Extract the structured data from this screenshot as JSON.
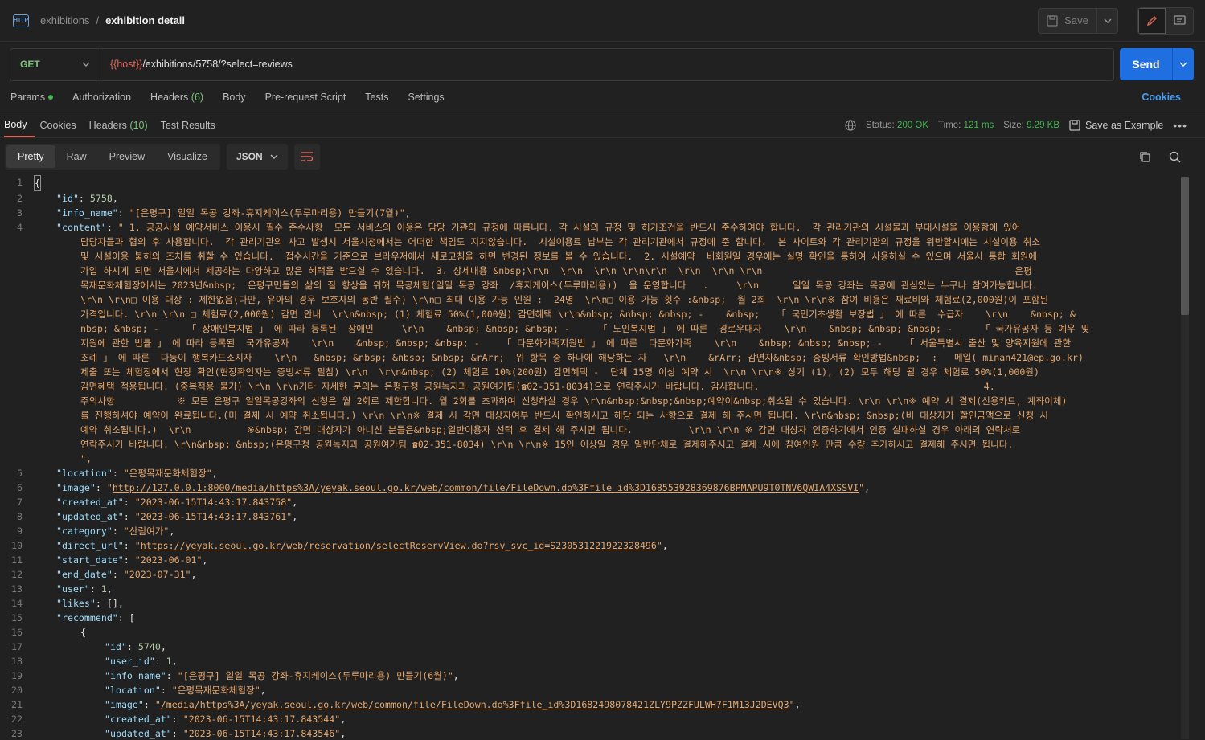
{
  "breadcrumb": {
    "parent": "exhibitions",
    "separator": "/",
    "current": "exhibition detail",
    "icon": "http-icon"
  },
  "toolbar": {
    "save_label": "Save"
  },
  "request": {
    "method": "GET",
    "url_var": "{{host}}",
    "url_path": "/exhibitions/5758/?select=reviews",
    "send_label": "Send"
  },
  "request_tabs": {
    "params": "Params",
    "authorization": "Authorization",
    "headers": "Headers",
    "headers_count": "(6)",
    "body": "Body",
    "prerequest": "Pre-request Script",
    "tests": "Tests",
    "settings": "Settings",
    "cookies": "Cookies"
  },
  "response_tabs": {
    "body": "Body",
    "cookies": "Cookies",
    "headers": "Headers",
    "headers_count": "(10)",
    "test_results": "Test Results"
  },
  "response_status": {
    "status_label": "Status:",
    "status_value": "200 OK",
    "time_label": "Time:",
    "time_value": "121 ms",
    "size_label": "Size:",
    "size_value": "9.29 KB",
    "save_example": "Save as Example"
  },
  "view_tabs": {
    "pretty": "Pretty",
    "raw": "Raw",
    "preview": "Preview",
    "visualize": "Visualize",
    "format": "JSON"
  },
  "code": {
    "l1": "{",
    "id_key": "\"id\"",
    "id_val": "5758",
    "info_key": "\"info_name\"",
    "info_val": "\"[은평구] 일일 목공 강좌-휴지케이스(두루마리용) 만들기(7월)\"",
    "content_key": "\"content\"",
    "content_lines": [
      "\" 1. 공공시설 예약서비스 이용시 필수 준수사항  모든 서비스의 이용은 담당 기관의 규정에 따릅니다. 각 시설의 규정 및 허가조건을 반드시 준수하여야 합니다.  각 관리기관의 시설물과 부대시설을 이용함에 있어",
      "담당자들과 협의 후 사용합니다.  각 관리기관의 사고 발생시 서울시청에서는 어떠한 책임도 지지않습니다.  시설이용료 납부는 각 관리기관에서 규정에 준 합니다.  본 사이트와 각 관리기관의 규정을 위반할시에는 시설이용 취소",
      "및 시설이용 불허의 조치를 취할 수 있습니다.  접수시간을 기준으로 브라우저에서 새로고침을 하면 변경된 정보를 볼 수 있습니다.  2. 시설예약  비회원일 경우에는 실명 확인을 통하여 사용하실 수 있으며 서울시 통합 회원에",
      "가입 하시게 되면 서울시에서 제공하는 다양하고 많은 혜택을 받으실 수 있습니다.  3. 상세내용 &nbsp;\\r\\n  \\r\\n  \\r\\n \\r\\n\\r\\n  \\r\\n  \\r\\n \\r\\n                                             은평",
      "목재문화체험장에서는 2023년&nbsp;  은평구민들의 삶의 질 향상을 위해 목공체험(일일 목공 강좌  /휴지케이스(두루마리용))  을 운영합니다   .     \\r\\n      일일 목공 강좌는 목공에 관심있는 누구나 참여가능합니다.",
      "\\r\\n \\r\\n□ 이용 대상 : 제한없음(다만, 유아의 경우 보호자의 동반 필수) \\r\\n□ 최대 이용 가능 인원 :  24명  \\r\\n□ 이용 가능 횟수 :&nbsp;  월 2회  \\r\\n \\r\\n※ 참여 비용은 재료비와 체험료(2,000원)이 포함된",
      "가격입니다. \\r\\n \\r\\n □ 체험료(2,000원) 감면 안내  \\r\\n&nbsp; (1) 체험료 50%(1,000원) 감면혜택 \\r\\n&nbsp; &nbsp; &nbsp; -    &nbsp;   「 국민기초생활 보장법 」 에 따른  수급자    \\r\\n    &nbsp; &",
      "nbsp; &nbsp; -     「 장애인복지법 」 에 따라 등록된  장애인     \\r\\n    &nbsp; &nbsp; &nbsp; -     「 노인복지법 」 에 따른  경로우대자    \\r\\n    &nbsp; &nbsp; &nbsp; -     「 국가유공자 등 예우 및",
      "지원에 관한 법률 」 에 따라 등록된  국가유공자    \\r\\n    &nbsp; &nbsp; &nbsp; -    「 다문화가족지원법 」 에 따른  다문화가족    \\r\\n    &nbsp; &nbsp; &nbsp; -    「 서울특별시 출산 및 양육지원에 관한",
      "조례 」 에 따른  다둥이 행복카드소지자    \\r\\n   &nbsp; &nbsp; &nbsp; &nbsp; &rArr;  위 항목 중 하나에 해당하는 자   \\r\\n    &rArr; 감면자&nbsp; 증빙서류 확인방법&nbsp;  :   메일( minan421@ep.go.kr)",
      "제출 또는 체험장에서 현장 확인(현장확인자는 증빙서류 필참) \\r\\n  \\r\\n&nbsp; (2) 체험료 10%(200원) 감면혜택 -  단체 15명 이상 예약 시  \\r\\n \\r\\n※ 상기 (1), (2) 모두 해당 될 경우 체험료 50%(1,000원)",
      "감면혜택 적용됩니다. (중복적용 불가) \\r\\n \\r\\n기타 자세한 문의는 은평구청 공원녹지과 공원여가팀(☎02-351-8034)으로 연락주시기 바랍니다. 감사합니다.                                        4.",
      "주의사항           ※ 모든 은평구 일일목공강좌의 신청은 월 2회로 제한합니다. 월 2회를 초과하여 신청하실 경우 \\r\\n&nbsp;&nbsp;&nbsp;예약이&nbsp;취소될 수 있습니다. \\r\\n \\r\\n※ 예약 시 결제(신용카드, 계좌이체)",
      "를 진행하셔야 예약이 완료됩니다.(미 결제 시 예약 취소됩니다.) \\r\\n \\r\\n※ 결제 시 감면 대상자여부 반드시 확인하시고 해당 되는 사항으로 결제 해 주시면 됩니다. \\r\\n&nbsp; &nbsp;(비 대상자가 할인금액으로 신청 시",
      "예약 취소됩니다.)  \\r\\n          ※&nbsp; 감면 대상자가 아니신 분들은&nbsp;일반이용자 선택 후 결제 해 주시면 됩니다.          \\r\\n \\r\\n ※ 감면 대상자 인증하기에서 인증 실패하실 경우 아래의 연락처로",
      "연락주시기 바랍니다. \\r\\n&nbsp; &nbsp;(은평구청 공원녹지과 공원여가팀 ☎02-351-8034) \\r\\n \\r\\n※ 15인 이상일 경우 일반단체로 결제해주시고 결제 시에 참여인원 만큼 수량 추가하시고 결제해 주시면 됩니다.",
      "\","
    ],
    "location_key": "\"location\"",
    "location_val": "\"은평목재문화체험장\"",
    "image_key": "\"image\"",
    "image_val": "http://127.0.0.1:8000/media/https%3A/yeyak.seoul.go.kr/web/common/file/FileDown.do%3Ffile_id%3D168553928369876BPMAPU9T0TNV6QWIA4XSSVI",
    "created_key": "\"created_at\"",
    "created_val": "\"2023-06-15T14:43:17.843758\"",
    "updated_key": "\"updated_at\"",
    "updated_val": "\"2023-06-15T14:43:17.843761\"",
    "category_key": "\"category\"",
    "category_val": "\"산림여가\"",
    "direct_key": "\"direct_url\"",
    "direct_val": "https://yeyak.seoul.go.kr/web/reservation/selectReservView.do?rsv_svc_id=S230531221922328496",
    "start_key": "\"start_date\"",
    "start_val": "\"2023-06-01\"",
    "end_key": "\"end_date\"",
    "end_val": "\"2023-07-31\"",
    "user_key": "\"user\"",
    "user_val": "1",
    "likes_key": "\"likes\"",
    "likes_val": "[]",
    "recommend_key": "\"recommend\"",
    "recommend_open": "[",
    "obj_open": "{",
    "r_id_key": "\"id\"",
    "r_id_val": "5740",
    "r_user_key": "\"user_id\"",
    "r_user_val": "1",
    "r_info_key": "\"info_name\"",
    "r_info_val": "\"[은평구] 일일 목공 강좌-휴지케이스(두루마리용) 만들기(6월)\"",
    "r_loc_key": "\"location\"",
    "r_loc_val": "\"은평목재문화체험장\"",
    "r_image_key": "\"image\"",
    "r_image_val": "/media/https%3A/yeyak.seoul.go.kr/web/common/file/FileDown.do%3Ffile_id%3D1682498078421ZLY9PZZFULWH7F1M13J2DEVQ3",
    "r_created_key": "\"created_at\"",
    "r_created_val": "\"2023-06-15T14:43:17.843544\"",
    "r_updated_key": "\"updated_at\"",
    "r_updated_val": "\"2023-06-15T14:43:17.843546\""
  }
}
